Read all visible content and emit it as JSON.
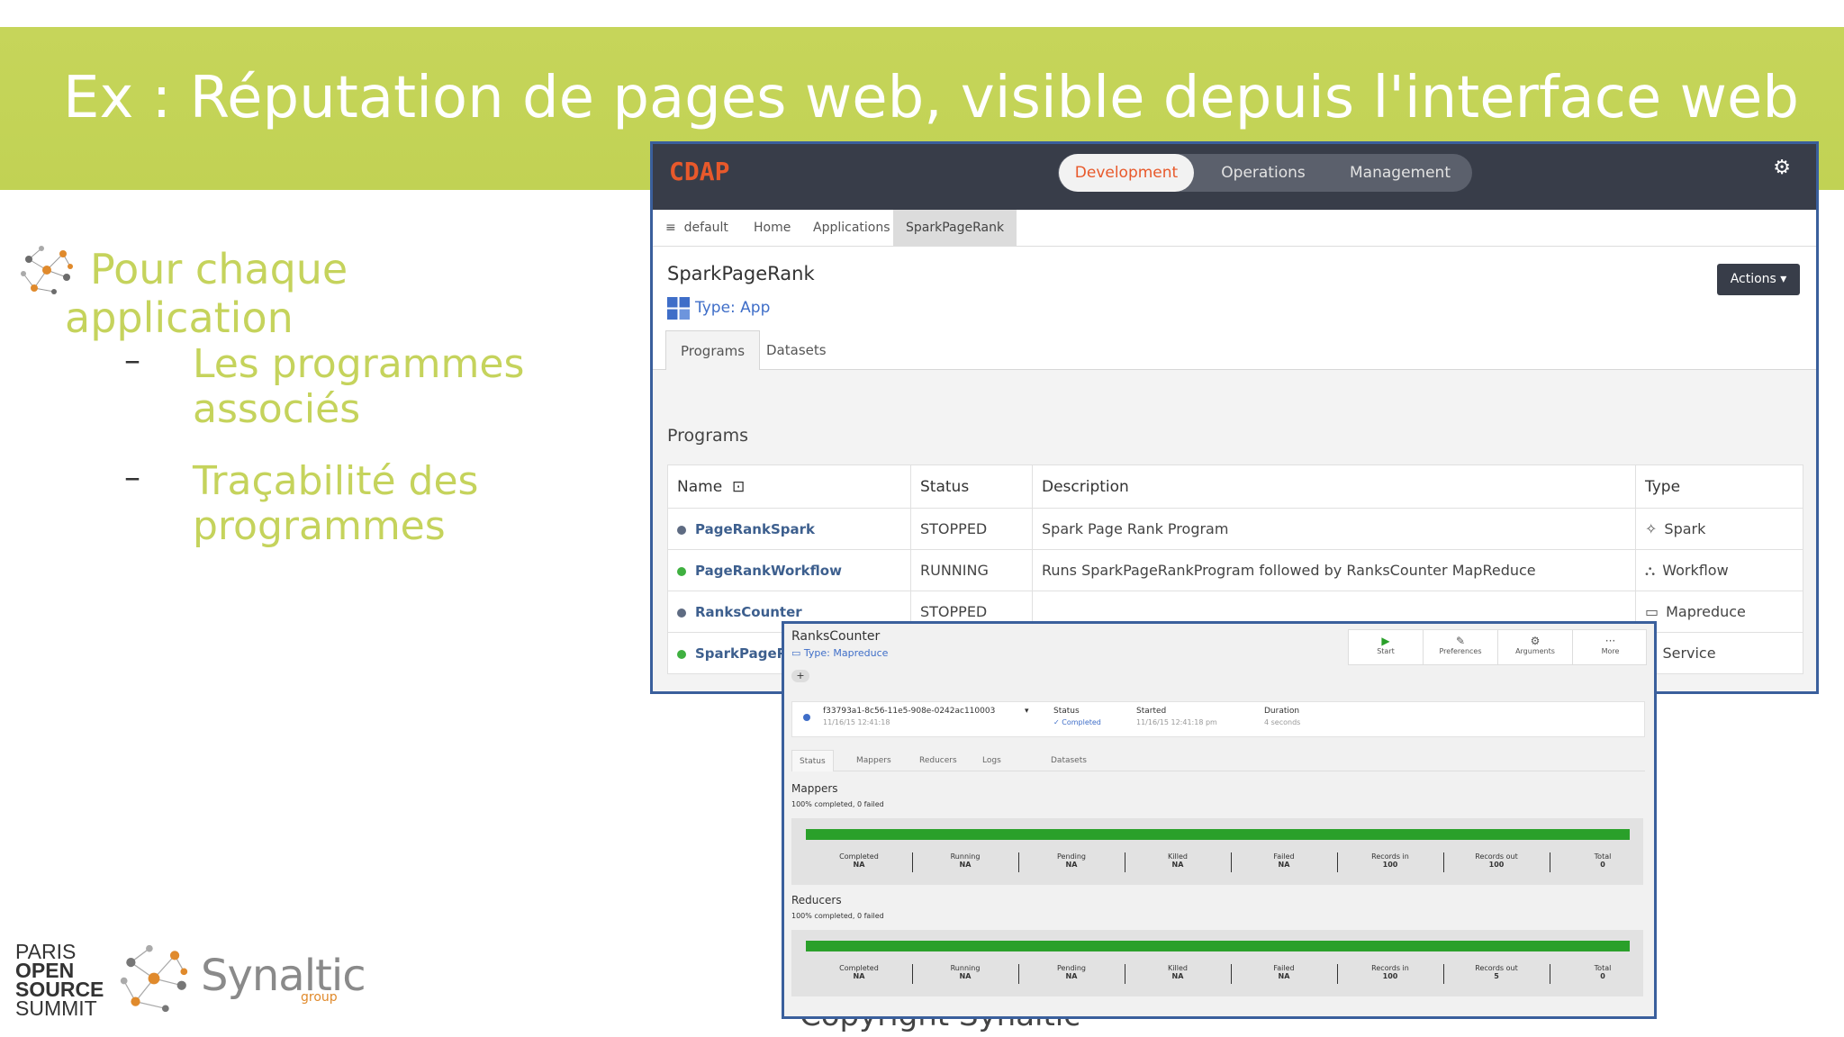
{
  "slide": {
    "title": "Ex : Réputation de pages web, visible depuis l'interface web",
    "bullet_main_line1": "Pour chaque",
    "bullet_main_line2": "application",
    "sub1_line1": "Les programmes",
    "sub1_line2": "associés",
    "sub2_line1": "Traçabilité des",
    "sub2_line2": "programmes",
    "dash": "–",
    "copyright": "Copyright Synaltic",
    "colors": {
      "band": "#c3d357",
      "accent_text": "#c5d35c"
    }
  },
  "logos": {
    "pos": [
      "PARIS",
      "OPEN",
      "SOURCE",
      "SUMMIT"
    ],
    "synaltic": "Synaltic",
    "synaltic_sub": "group"
  },
  "cdap": {
    "logo": "CDAP",
    "nav": [
      "Development",
      "Operations",
      "Management"
    ],
    "active_nav": "Development",
    "gear_icon": "gear-icon",
    "breadcrumbs": [
      "default",
      "Home",
      "Applications",
      "SparkPageRank"
    ],
    "app_name": "SparkPageRank",
    "app_type": "Type: App",
    "actions_label": "Actions",
    "tabs": [
      "Programs",
      "Datasets"
    ],
    "programs_title": "Programs",
    "columns": [
      "Name",
      "Status",
      "Description",
      "Type"
    ],
    "rows": [
      {
        "name": "PageRankSpark",
        "status": "STOPPED",
        "description": "Spark Page Rank Program",
        "type": "Spark",
        "dot": "#5e6b82",
        "icon": "✧"
      },
      {
        "name": "PageRankWorkflow",
        "status": "RUNNING",
        "description": "Runs SparkPageRankProgram followed by RanksCounter MapReduce",
        "type": "Workflow",
        "dot": "#3fb040",
        "icon": "⛬"
      },
      {
        "name": "RanksCounter",
        "status": "STOPPED",
        "description": "",
        "type": "Mapreduce",
        "dot": "#5e6b82",
        "icon": "▭"
      },
      {
        "name": "SparkPageR",
        "status": "",
        "description": "",
        "type": "Service",
        "dot": "#3fb040",
        "icon": "⧉"
      }
    ]
  },
  "rc": {
    "name": "RanksCounter",
    "type": "Type: Mapreduce",
    "tools": [
      "Start",
      "Preferences",
      "Arguments",
      "More"
    ],
    "run_id": "f33793a1-8c56-11e5-908e-0242ac110003",
    "run_date": "11/16/15 12:41:18",
    "status_label": "Status",
    "status_value": "✓ Completed",
    "started_label": "Started",
    "started_value": "11/16/15 12:41:18 pm",
    "duration_label": "Duration",
    "duration_value": "4 seconds",
    "tabs": [
      "Status",
      "Mappers",
      "Reducers",
      "Logs",
      "Datasets"
    ],
    "mappers": {
      "title": "Mappers",
      "summary": "100% completed, 0 failed",
      "progress": 1.0,
      "stats": [
        {
          "label": "Completed",
          "value": "NA"
        },
        {
          "label": "Running",
          "value": "NA"
        },
        {
          "label": "Pending",
          "value": "NA"
        },
        {
          "label": "Killed",
          "value": "NA"
        },
        {
          "label": "Failed",
          "value": "NA"
        },
        {
          "label": "Records in",
          "value": "100"
        },
        {
          "label": "Records out",
          "value": "100"
        },
        {
          "label": "Total",
          "value": "0"
        }
      ]
    },
    "reducers": {
      "title": "Reducers",
      "summary": "100% completed, 0 failed",
      "progress": 1.0,
      "stats": [
        {
          "label": "Completed",
          "value": "NA"
        },
        {
          "label": "Running",
          "value": "NA"
        },
        {
          "label": "Pending",
          "value": "NA"
        },
        {
          "label": "Killed",
          "value": "NA"
        },
        {
          "label": "Failed",
          "value": "NA"
        },
        {
          "label": "Records in",
          "value": "100"
        },
        {
          "label": "Records out",
          "value": "5"
        },
        {
          "label": "Total",
          "value": "0"
        }
      ]
    }
  }
}
